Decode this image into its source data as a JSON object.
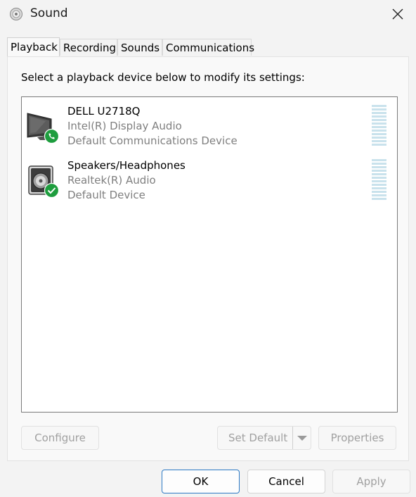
{
  "window": {
    "title": "Sound",
    "title_icon": "speaker-icon",
    "close_icon": "close-icon"
  },
  "tabs": [
    {
      "label": "Playback",
      "active": true
    },
    {
      "label": "Recording",
      "active": false
    },
    {
      "label": "Sounds",
      "active": false
    },
    {
      "label": "Communications",
      "active": false
    }
  ],
  "playback": {
    "instruction": "Select a playback device below to modify its settings:",
    "devices": [
      {
        "name": "DELL U2718Q",
        "driver": "Intel(R) Display Audio",
        "status": "Default Communications Device",
        "icon": "monitor-icon",
        "badge": "phone-badge-icon",
        "level": 0
      },
      {
        "name": "Speakers/Headphones",
        "driver": "Realtek(R) Audio",
        "status": "Default Device",
        "icon": "speaker-icon",
        "badge": "check-badge-icon",
        "level": 0
      }
    ],
    "buttons": {
      "configure": "Configure",
      "set_default": "Set Default",
      "properties": "Properties"
    }
  },
  "footer": {
    "ok": "OK",
    "cancel": "Cancel",
    "apply": "Apply"
  },
  "colors": {
    "badge_green": "#1e9d3e",
    "meter": "#c9e2ec",
    "primary_border": "#2b78c4"
  }
}
